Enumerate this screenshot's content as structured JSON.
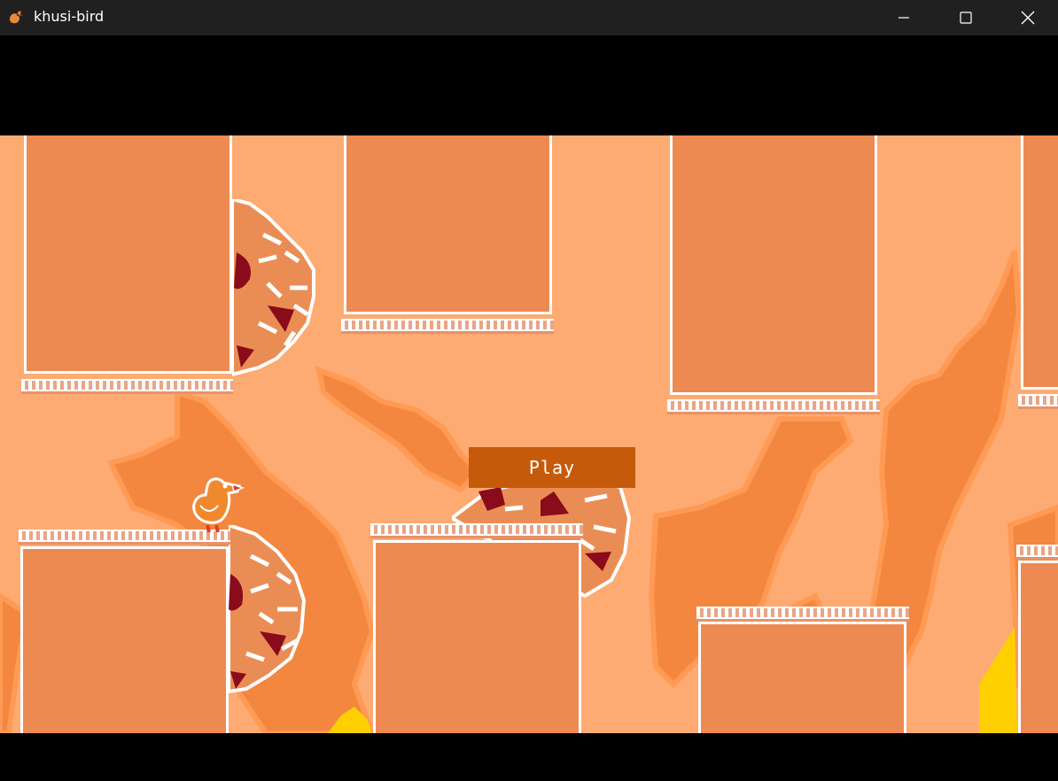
{
  "window": {
    "title": "khusi-bird",
    "icons": {
      "app": "bird-app-icon",
      "minimize": "minimize-icon",
      "maximize": "maximize-icon",
      "close": "close-icon"
    }
  },
  "game": {
    "play_label": "Play",
    "colors": {
      "background": "#fdab72",
      "pipe": "#ed8a52",
      "flame": "#f4873f",
      "button": "#c65a0b",
      "pizza_topping": "#8a0b1a",
      "fire_yellow": "#ffd000"
    }
  }
}
